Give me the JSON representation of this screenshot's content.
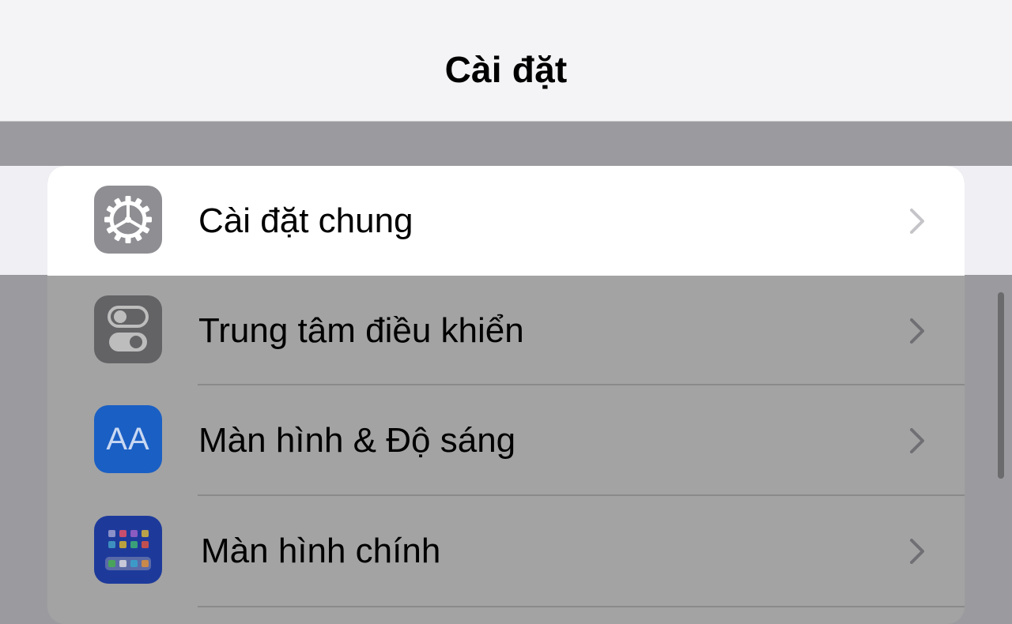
{
  "navbar": {
    "title": "Cài đặt"
  },
  "settings": {
    "items": [
      {
        "label": "Cài đặt chung",
        "icon": "gear-icon",
        "icon_bg": "#8e8e93",
        "highlighted": true
      },
      {
        "label": "Trung tâm điều khiển",
        "icon": "control-center-icon",
        "icon_bg": "#636366",
        "highlighted": false
      },
      {
        "label": "Màn hình & Độ sáng",
        "icon": "display-brightness-icon",
        "icon_bg": "#1a66cf",
        "highlighted": false
      },
      {
        "label": "Màn hình chính",
        "icon": "home-screen-icon",
        "icon_bg": "#1d3a9b",
        "highlighted": false
      }
    ]
  },
  "display_icon_text": "AA",
  "colors": {
    "chevron": "#9a9aa0",
    "chevron_dimmed": "#6f6f74"
  }
}
